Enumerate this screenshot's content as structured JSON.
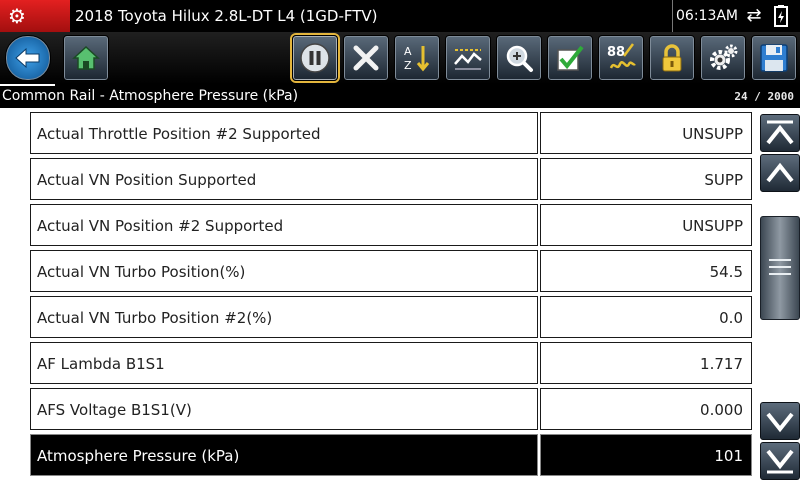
{
  "header": {
    "title": "2018 Toyota Hilux 2.8L-DT L4 (1GD-FTV)",
    "clock": "06:13AM",
    "logo_icon": "scan-tool-logo-icon",
    "status_icons": [
      "connection-status-icon",
      "battery-icon"
    ]
  },
  "toolbar": {
    "buttons": [
      {
        "name": "back",
        "icon": "back-arrow-icon"
      },
      {
        "name": "home",
        "icon": "home-icon"
      },
      {
        "name": "pause",
        "icon": "pause-icon",
        "selected": true
      },
      {
        "name": "clear",
        "icon": "close-icon"
      },
      {
        "name": "sort",
        "icon": "sort-icon"
      },
      {
        "name": "graph",
        "icon": "graph-icon"
      },
      {
        "name": "zoom",
        "icon": "zoom-icon"
      },
      {
        "name": "select",
        "icon": "checkmark-icon"
      },
      {
        "name": "units",
        "icon": "units-icon"
      },
      {
        "name": "lock",
        "icon": "lock-icon"
      },
      {
        "name": "settings",
        "icon": "gear-icon"
      },
      {
        "name": "save",
        "icon": "save-icon"
      }
    ]
  },
  "status": {
    "parameter_title": "Common Rail - Atmosphere Pressure (kPa)",
    "page_counter": "24 / 2000"
  },
  "rows": [
    {
      "name": "Actual Throttle Position #2 Supported",
      "value": "UNSUPP",
      "selected": false
    },
    {
      "name": "Actual VN Position Supported",
      "value": "SUPP",
      "selected": false
    },
    {
      "name": "Actual VN Position #2 Supported",
      "value": "UNSUPP",
      "selected": false
    },
    {
      "name": "Actual VN Turbo Position(%)",
      "value": "54.5",
      "selected": false
    },
    {
      "name": "Actual VN Turbo Position #2(%)",
      "value": "0.0",
      "selected": false
    },
    {
      "name": "AF Lambda B1S1",
      "value": "1.717",
      "selected": false
    },
    {
      "name": "AFS Voltage B1S1(V)",
      "value": "0.000",
      "selected": false
    },
    {
      "name": "Atmosphere Pressure (kPa)",
      "value": "101",
      "selected": true
    }
  ],
  "scrollbar": {
    "buttons": [
      "scroll-top-icon",
      "scroll-up-icon",
      "scroll-down-icon",
      "scroll-bottom-icon"
    ]
  },
  "colors": {
    "accent_red": "#c81414",
    "selection_outline": "#e3b53d",
    "selected_row_bg": "#000000"
  }
}
